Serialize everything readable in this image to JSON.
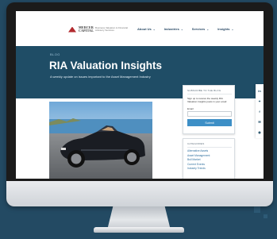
{
  "nav": {
    "items": [
      {
        "label": "About Us",
        "chevron": "chevron-down-icon"
      },
      {
        "label": "Industries",
        "chevron": "chevron-down-icon"
      },
      {
        "label": "Services",
        "chevron": "chevron-down-icon"
      },
      {
        "label": "Insights",
        "chevron": "chevron-down-icon"
      }
    ]
  },
  "logo": {
    "name_line1": "MERCER",
    "name_line2": "CAPITAL",
    "tagline": "Business Valuation & Financial Advisory Services"
  },
  "hero": {
    "kicker": "BLOG",
    "title": "RIA Valuation Insights",
    "subtitle": "A weekly update on issues important to the Asset Management Industry"
  },
  "subscribe": {
    "title": "SUBSCRIBE TO THE BLOG",
    "text": "Sign up to receive the weekly RIA Valuation Insights posts in your email",
    "email_label": "Email",
    "email_value": "",
    "button_label": "Submit"
  },
  "categories": {
    "title": "CATEGORIES",
    "items": [
      "Alternative Assets",
      "Asset Management",
      "Bull Market",
      "Current Events",
      "Industry Trends"
    ]
  },
  "social": {
    "icons": [
      {
        "name": "linkedin-icon",
        "glyph": "in"
      },
      {
        "name": "twitter-icon",
        "glyph": "✦"
      },
      {
        "name": "facebook-icon",
        "glyph": "f"
      },
      {
        "name": "email-icon",
        "glyph": "✉"
      },
      {
        "name": "rss-icon",
        "glyph": "◉"
      }
    ]
  },
  "colors": {
    "background": "#234a63",
    "hero": "#1f4d66",
    "accent": "#3d8fc6",
    "brand_red": "#b22a2e"
  }
}
